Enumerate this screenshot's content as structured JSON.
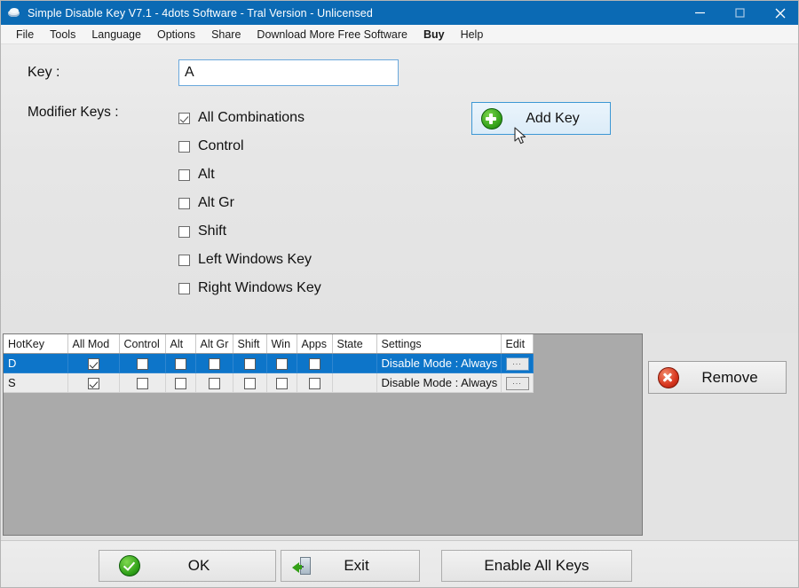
{
  "window": {
    "title": "Simple Disable Key V7.1 - 4dots Software - Tral Version - Unlicensed",
    "app_icon": "app-disc-icon",
    "controls": {
      "minimize": "minimize-icon",
      "maximize": "maximize-icon",
      "close": "close-icon"
    },
    "titlebar_color": "#0b6ab4"
  },
  "menu": {
    "items": [
      {
        "label": "File",
        "bold": false
      },
      {
        "label": "Tools",
        "bold": false
      },
      {
        "label": "Language",
        "bold": false
      },
      {
        "label": "Options",
        "bold": false
      },
      {
        "label": "Share",
        "bold": false
      },
      {
        "label": "Download More Free Software",
        "bold": false
      },
      {
        "label": "Buy",
        "bold": true
      },
      {
        "label": "Help",
        "bold": false
      }
    ]
  },
  "form": {
    "key_label": "Key :",
    "key_value": "A",
    "key_placeholder": "",
    "modifier_label": "Modifier Keys :",
    "modifiers": [
      {
        "label": "All Combinations",
        "checked": true
      },
      {
        "label": "Control",
        "checked": false
      },
      {
        "label": "Alt",
        "checked": false
      },
      {
        "label": "Alt Gr",
        "checked": false
      },
      {
        "label": "Shift",
        "checked": false
      },
      {
        "label": "Left Windows Key",
        "checked": false
      },
      {
        "label": "Right Windows Key",
        "checked": false
      }
    ],
    "add_key_label": "Add Key",
    "add_key_icon": "green-plus-icon"
  },
  "table": {
    "columns": [
      "HotKey",
      "All Mod",
      "Control",
      "Alt",
      "Alt Gr",
      "Shift",
      "Win",
      "Apps",
      "State",
      "Settings",
      "Edit"
    ],
    "rows": [
      {
        "hotkey": "D",
        "all_mod": true,
        "control": false,
        "alt": false,
        "alt_gr": false,
        "shift": false,
        "win": false,
        "apps": false,
        "state": "",
        "settings": "Disable Mode : Always",
        "edit": "...",
        "selected": true
      },
      {
        "hotkey": "S",
        "all_mod": true,
        "control": false,
        "alt": false,
        "alt_gr": false,
        "shift": false,
        "win": false,
        "apps": false,
        "state": "",
        "settings": "Disable Mode : Always",
        "edit": "...",
        "selected": false
      }
    ],
    "selection_color": "#0d75c9",
    "empty_area_color": "#aaaaaa"
  },
  "remove": {
    "label": "Remove",
    "icon": "red-x-icon"
  },
  "footer": {
    "ok_label": "OK",
    "ok_icon": "green-check-icon",
    "exit_label": "Exit",
    "exit_icon": "exit-door-icon",
    "enable_all_label": "Enable All Keys"
  }
}
